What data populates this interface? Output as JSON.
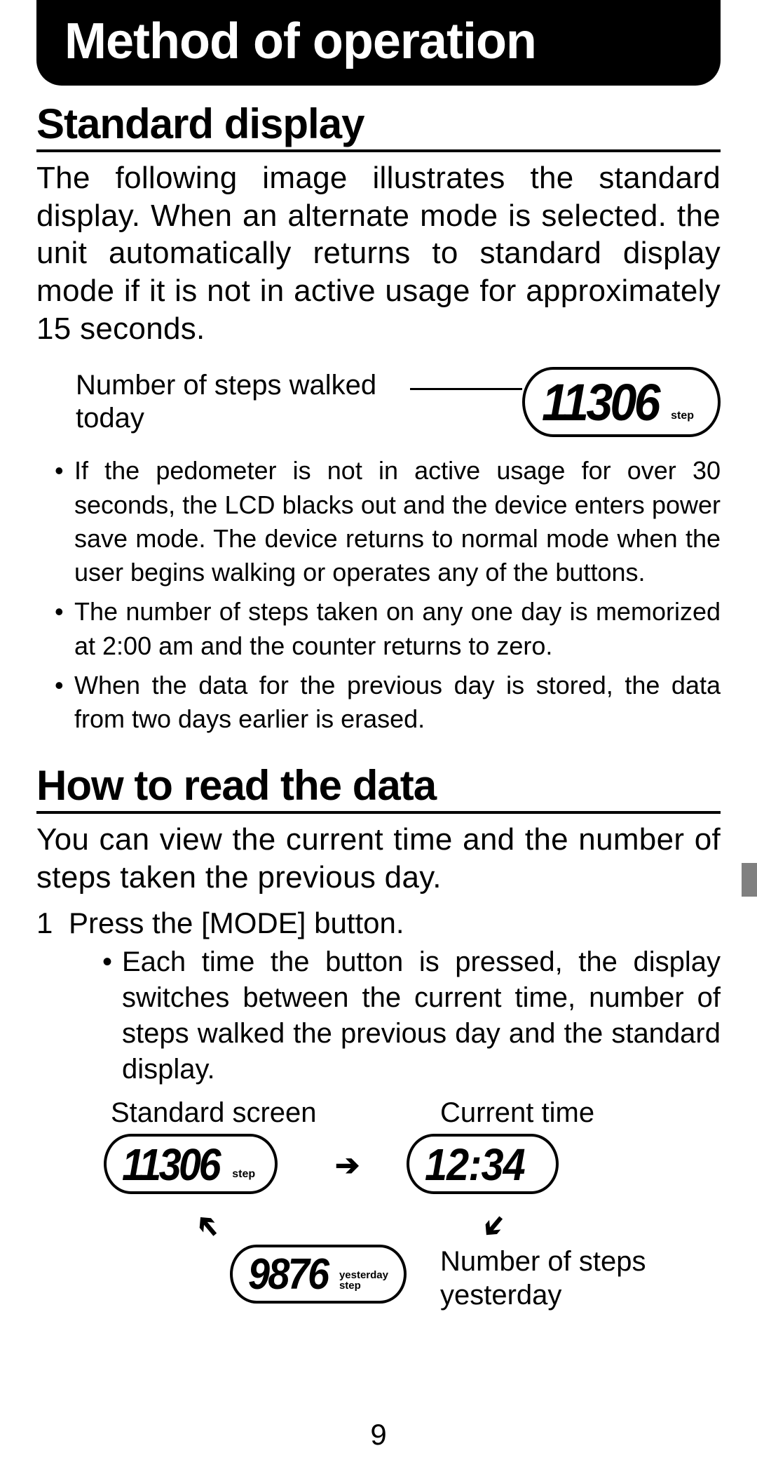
{
  "title": "Method of operation",
  "section1": {
    "heading": "Standard display",
    "intro": "The following image illustrates the standard display. When an alternate mode is selected. the unit automatically returns to standard display mode if it is not in active usage for approximately 15 seconds.",
    "figure": {
      "label": "Number of steps walked today",
      "value": "11306",
      "unit": "step"
    },
    "bullets": [
      "If the pedometer is not in active usage for over 30 seconds, the LCD blacks out and the device enters power save mode. The device returns to normal mode when the user begins walking or operates any of the buttons.",
      "The number of steps taken on any one day is memorized at 2:00 am and the counter returns to zero.",
      "When the data for the previous day is stored, the data from two days earlier is erased."
    ]
  },
  "section2": {
    "heading": "How to read the data",
    "intro": "You can view the current time and the number of steps taken the previous day.",
    "step_num": "1",
    "step_text": "Press the [MODE] button.",
    "sub_bullet": "Each time the button is pressed, the display switches between the current time, number of steps walked the previous day and the standard display.",
    "diagram": {
      "label_standard": "Standard screen",
      "label_time": "Current time",
      "label_yesterday": "Number of steps yesterday",
      "standard_value": "11306",
      "standard_unit": "step",
      "time_value": "12:34",
      "yesterday_value": "9876",
      "yesterday_unit1": "yesterday",
      "yesterday_unit2": "step"
    }
  },
  "page_number": "9"
}
